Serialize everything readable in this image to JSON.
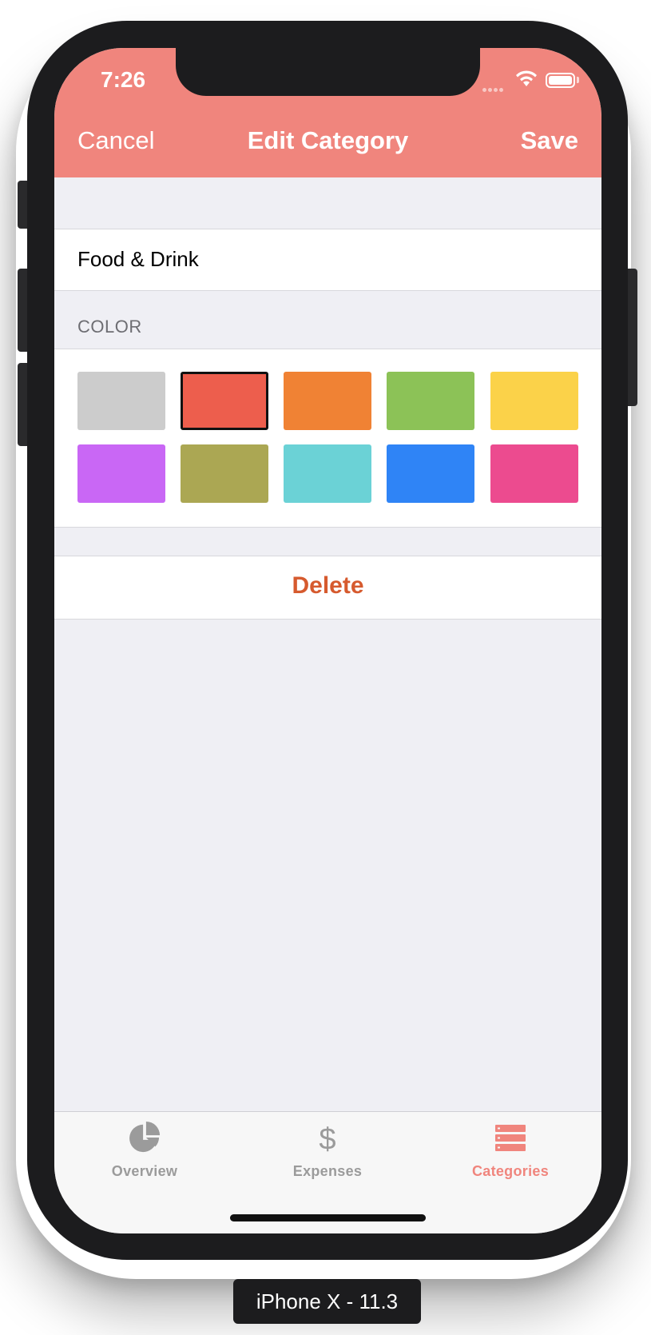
{
  "status_bar": {
    "time": "7:26"
  },
  "nav": {
    "cancel_label": "Cancel",
    "title": "Edit Category",
    "save_label": "Save"
  },
  "category": {
    "name": "Food & Drink"
  },
  "color_section": {
    "label": "COLOR",
    "selected": "red",
    "swatches": [
      {
        "name": "gray",
        "hex": "#cccccc"
      },
      {
        "name": "red",
        "hex": "#ed5e4d"
      },
      {
        "name": "orange",
        "hex": "#f08234"
      },
      {
        "name": "green",
        "hex": "#8cc257"
      },
      {
        "name": "yellow",
        "hex": "#fbd249"
      },
      {
        "name": "purple",
        "hex": "#c967f5"
      },
      {
        "name": "olive",
        "hex": "#aba753"
      },
      {
        "name": "teal",
        "hex": "#6bd2d6"
      },
      {
        "name": "blue",
        "hex": "#2f84f6"
      },
      {
        "name": "pink",
        "hex": "#ec4b8f"
      }
    ]
  },
  "actions": {
    "delete_label": "Delete"
  },
  "tabbar": {
    "active": "Categories",
    "items": [
      {
        "label": "Overview",
        "icon": "pie-chart-icon"
      },
      {
        "label": "Expenses",
        "icon": "dollar-icon"
      },
      {
        "label": "Categories",
        "icon": "list-icon"
      }
    ]
  },
  "device": {
    "label": "iPhone X - 11.3"
  },
  "colors": {
    "accent": "#f0857d",
    "tab_inactive": "#9b9b9b",
    "delete": "#d65a2e",
    "background": "#efeff4"
  }
}
